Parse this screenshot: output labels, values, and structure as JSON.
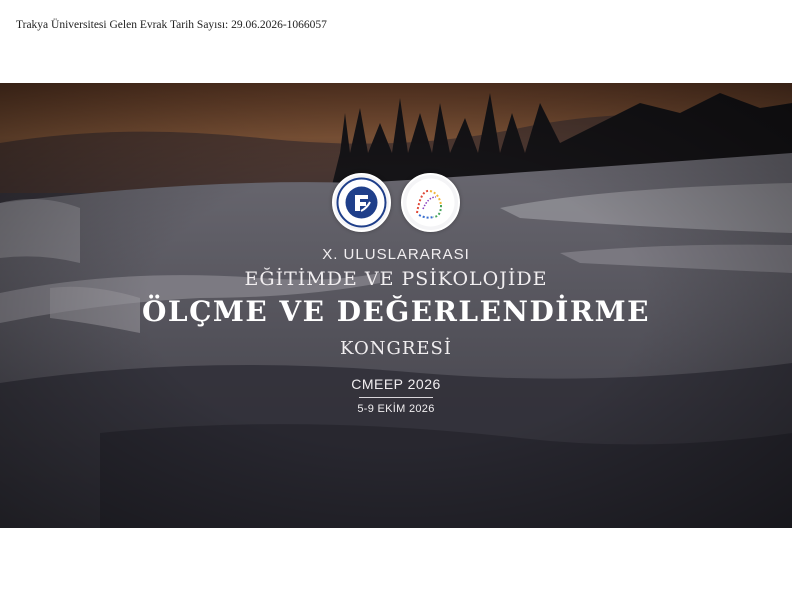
{
  "header": {
    "text": "Trakya Üniversitesi Gelen Evrak Tarih Sayısı: 29.06.2026-1066057"
  },
  "banner": {
    "logo_left": {
      "icon": "pamukkale-university-logo-icon",
      "ring_text": "PAMUKKALE ÜNİVERSİTESİ",
      "bottom_text": "DENİZLİ",
      "year": "1992"
    },
    "logo_right": {
      "icon": "epodder-logo-icon",
      "text": "EPODDER"
    },
    "line1": "X. ULUSLARARASI",
    "line2": "EĞİTİMDE VE PSİKOLOJİDE",
    "line3": "ÖLÇME VE DEĞERLENDİRME",
    "line4": "KONGRESİ",
    "code": "CMEEP 2026",
    "dates": "5-9 EKİM 2026"
  },
  "colors": {
    "text": "#f1eef0",
    "sky_warm": "#b07a52",
    "travertine": "#c9c7cf"
  }
}
